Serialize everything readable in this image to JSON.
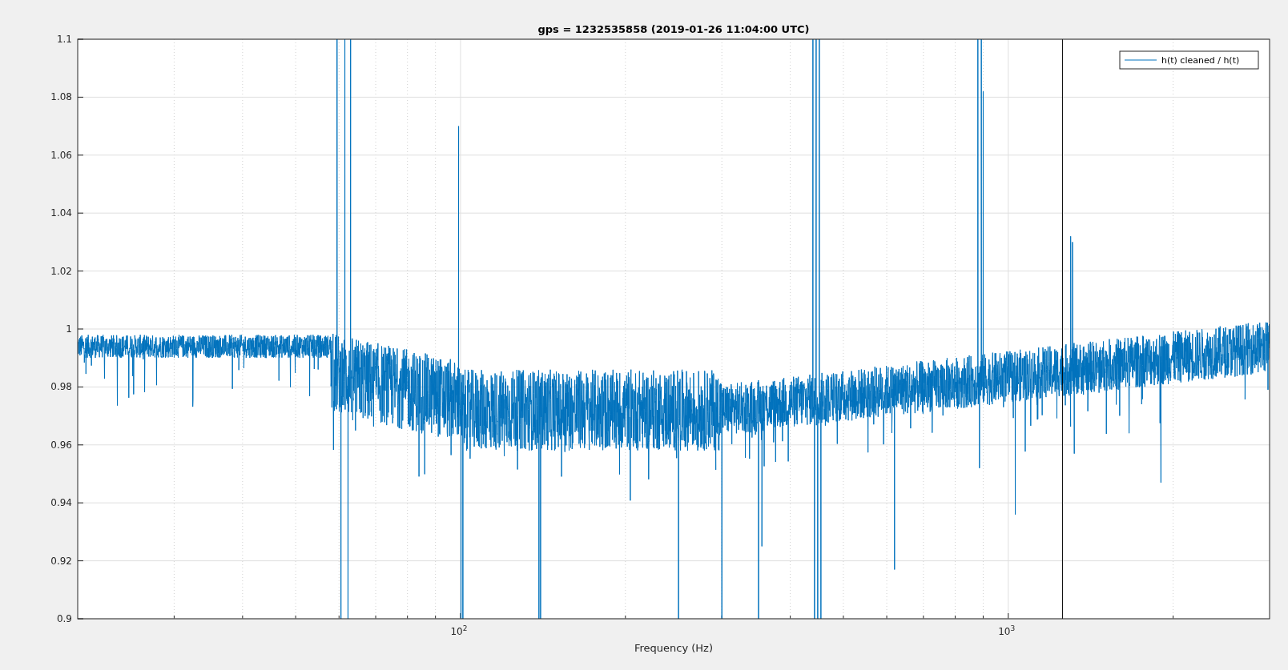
{
  "figure": {
    "title": "gps = 1232535858 (2019-01-26 11:04:00 UTC)",
    "x_axis": {
      "label": "Frequency (Hz)",
      "ticks": [
        "10$^{2}$",
        "10$^{3}$"
      ]
    },
    "y_axis": {
      "ticks": [
        "1.1",
        "1.08",
        "1.06",
        "1.04",
        "1.02",
        "1",
        "0.98",
        "0.96",
        "0.94",
        "0.92",
        "0.9"
      ]
    },
    "legend": {
      "entries": [
        "h(t) cleaned / h(t)"
      ]
    }
  }
}
